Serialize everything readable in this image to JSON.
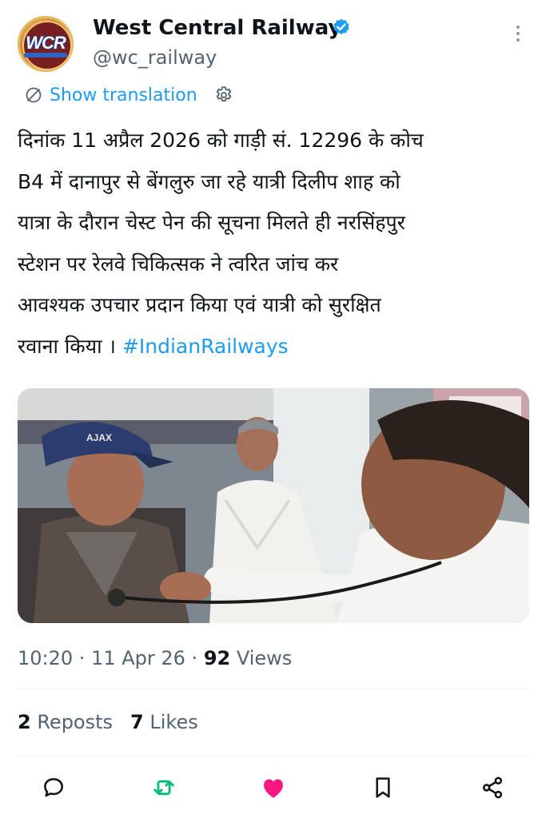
{
  "account": {
    "name": "West Central Railway",
    "handle": "@wc_railway",
    "avatar_text": "WCR",
    "verified": true
  },
  "translate": {
    "label": "Show translation"
  },
  "tweet": {
    "lines": [
      "दिनांक 11 अप्रैल 2026 को गाड़ी सं. 12296 के कोच",
      "B4 में दानापुर से बेंगलुरु जा रहे यात्री दिलीप शाह को",
      "यात्रा के दौरान चेस्ट पेन की सूचना मिलते ही नरसिंहपुर",
      "स्टेशन पर रेलवे चिकित्सक ने त्वरित जांच कर",
      "आवश्यक उपचार प्रदान किया एवं यात्री को सुरक्षित",
      "रवाना किया ।"
    ],
    "hashtag": "#IndianRailways"
  },
  "media": {
    "cap_text": "AJAX"
  },
  "meta": {
    "time": "10:20",
    "separator": " · ",
    "date": "11 Apr 26",
    "views_count": "92",
    "views_label": " Views"
  },
  "stats": {
    "reposts_count": "2",
    "reposts_label": " Reposts",
    "likes_count": "7",
    "likes_label": " Likes"
  },
  "actions": [
    {
      "icon": "reply-icon"
    },
    {
      "icon": "repost-icon",
      "color": "#00ba7c"
    },
    {
      "icon": "like-icon",
      "color": "#f91880"
    },
    {
      "icon": "bookmark-icon"
    },
    {
      "icon": "share-icon"
    }
  ],
  "colors": {
    "link": "#1d9bf0",
    "secondary": "#536471",
    "like": "#f91880",
    "repost": "#00ba7c"
  }
}
